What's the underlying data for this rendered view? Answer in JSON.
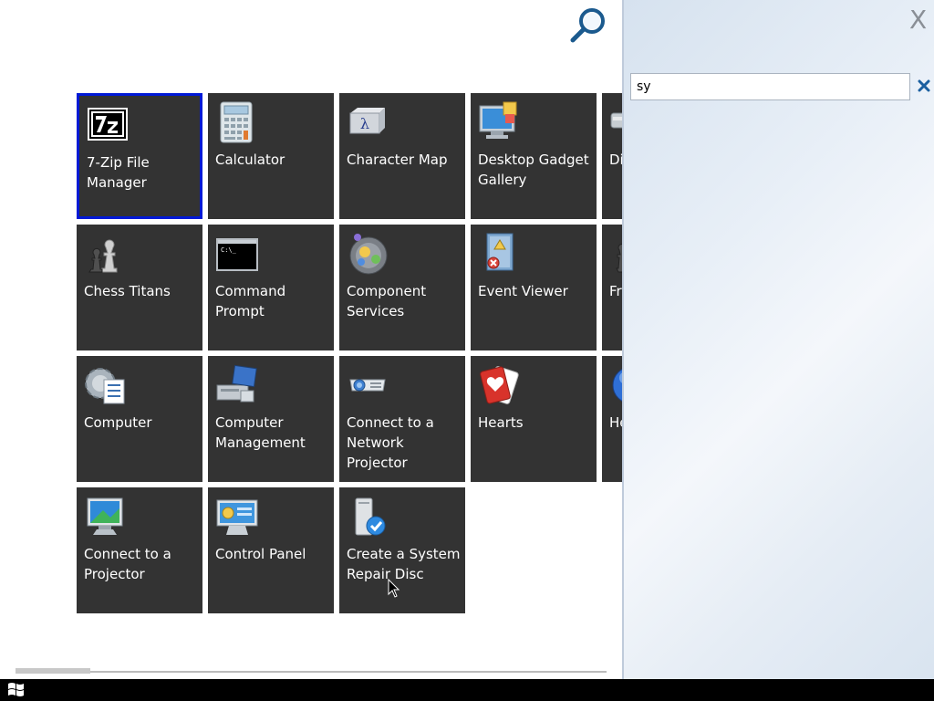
{
  "search": {
    "value": "sy",
    "close_label": "X",
    "clear_label": "×"
  },
  "tiles": [
    {
      "label": "7-Zip File Manager",
      "icon": "7zip-icon",
      "selected": true
    },
    {
      "label": "Calculator",
      "icon": "calculator-icon"
    },
    {
      "label": "Character Map",
      "icon": "character-map-icon"
    },
    {
      "label": "Desktop Gadget Gallery",
      "icon": "gadget-gallery-icon"
    },
    {
      "label": "Di",
      "icon": "disk-icon"
    },
    {
      "label": "Chess Titans",
      "icon": "chess-icon"
    },
    {
      "label": "Command Prompt",
      "icon": "command-prompt-icon"
    },
    {
      "label": "Component Services",
      "icon": "component-services-icon"
    },
    {
      "label": "Event Viewer",
      "icon": "event-viewer-icon"
    },
    {
      "label": "Fr",
      "icon": "freecell-icon"
    },
    {
      "label": "Computer",
      "icon": "computer-icon"
    },
    {
      "label": "Computer Management",
      "icon": "computer-management-icon"
    },
    {
      "label": "Connect to a Network Projector",
      "icon": "network-projector-icon"
    },
    {
      "label": "Hearts",
      "icon": "hearts-icon"
    },
    {
      "label": "He",
      "icon": "help-icon"
    },
    {
      "label": "Connect to a Projector",
      "icon": "projector-icon"
    },
    {
      "label": "Control Panel",
      "icon": "control-panel-icon"
    },
    {
      "label": "Create a System Repair Disc",
      "icon": "repair-disc-icon"
    }
  ],
  "colors": {
    "tile_bg": "#333333",
    "selected_border": "#0019d6",
    "accent": "#1a5fa0"
  },
  "icons": {
    "search": "magnifier-icon",
    "start": "windows-logo-icon"
  }
}
